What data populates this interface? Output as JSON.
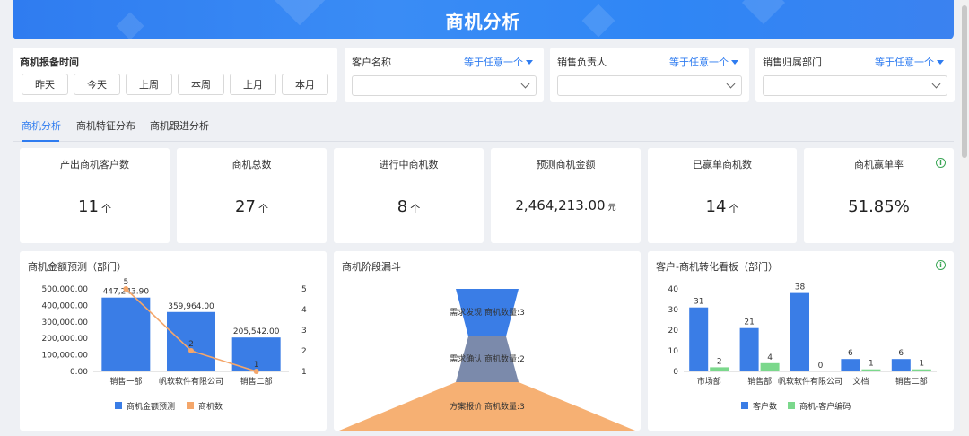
{
  "banner": {
    "title": "商机分析"
  },
  "time_filter": {
    "label": "商机报备时间",
    "buttons": [
      "昨天",
      "今天",
      "上周",
      "本周",
      "上月",
      "本月"
    ]
  },
  "filters": [
    {
      "label": "客户名称",
      "operator": "等于任意一个"
    },
    {
      "label": "销售负责人",
      "operator": "等于任意一个"
    },
    {
      "label": "销售归属部门",
      "operator": "等于任意一个"
    }
  ],
  "tabs": [
    "商机分析",
    "商机特征分布",
    "商机跟进分析"
  ],
  "kpis": [
    {
      "label": "产出商机客户数",
      "value": "11",
      "unit": "个"
    },
    {
      "label": "商机总数",
      "value": "27",
      "unit": "个"
    },
    {
      "label": "进行中商机数",
      "value": "8",
      "unit": "个"
    },
    {
      "label": "预测商机金额",
      "value": "2,464,213.00",
      "unit": "元"
    },
    {
      "label": "已赢单商机数",
      "value": "14",
      "unit": "个"
    },
    {
      "label": "商机赢单率",
      "value": "51.85%",
      "unit": ""
    }
  ],
  "icons": {
    "info": "info-icon",
    "chevron": "chevron-down-icon",
    "caret": "caret-down-icon"
  },
  "colors": {
    "accent": "#2f7cf0",
    "bar_blue": "#3a7de6",
    "line_orange": "#f4a66a",
    "bar_green": "#7bd88c",
    "funnel_blue": "#3a7de6",
    "funnel_slate": "#7b8aab",
    "funnel_orange": "#f6b073"
  },
  "chart_data": [
    {
      "type": "bar",
      "title": "商机金额预测（部门）",
      "categories": [
        "销售一部",
        "帆软软件有限公司",
        "销售二部"
      ],
      "series": [
        {
          "name": "商机金额预测",
          "kind": "bar",
          "axis": "left",
          "values": [
            447243.9,
            359964.0,
            205542.0
          ],
          "labels": [
            "447,243.90",
            "359,964.00",
            "205,542.00"
          ]
        },
        {
          "name": "商机数",
          "kind": "line",
          "axis": "right",
          "values": [
            5,
            2,
            1
          ],
          "labels": [
            "5",
            "2",
            "1"
          ]
        }
      ],
      "y_left": {
        "min": 0,
        "max": 500000,
        "ticks": [
          "0.00",
          "100,000.00",
          "200,000.00",
          "300,000.00",
          "400,000.00",
          "500,000.00"
        ]
      },
      "y_right": {
        "min": 1,
        "max": 5,
        "ticks": [
          "1",
          "2",
          "3",
          "4",
          "5"
        ]
      },
      "legend": "bottom"
    },
    {
      "type": "funnel",
      "title": "商机阶段漏斗",
      "stages": [
        {
          "label": "需求发现 商机数量:3",
          "value": 3
        },
        {
          "label": "需求确认 商机数量:2",
          "value": 2
        },
        {
          "label": "方案报价 商机数量:3",
          "value": 3
        }
      ]
    },
    {
      "type": "bar",
      "title": "客户-商机转化看板（部门）",
      "categories": [
        "市场部",
        "销售部",
        "帆软软件有限公司",
        "文档",
        "销售二部"
      ],
      "series": [
        {
          "name": "客户数",
          "values": [
            31,
            21,
            38,
            6,
            6
          ]
        },
        {
          "name": "商机-客户编码",
          "values": [
            2,
            4,
            0,
            1,
            1
          ]
        }
      ],
      "ylim": [
        0,
        40
      ],
      "y_ticks": [
        "0",
        "10",
        "20",
        "30",
        "40"
      ],
      "legend": "bottom"
    }
  ]
}
